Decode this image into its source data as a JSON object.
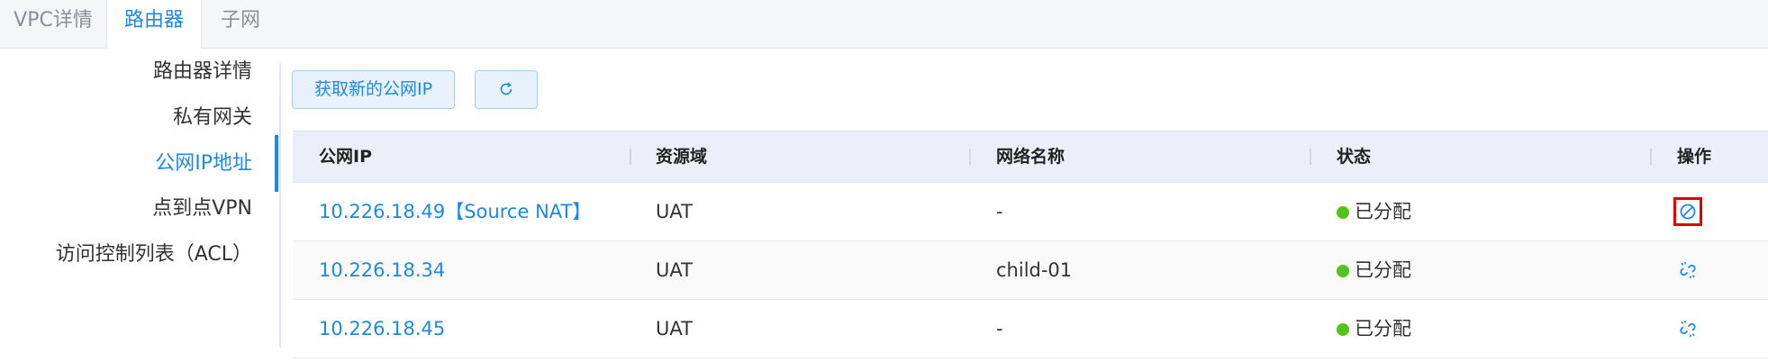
{
  "tabs": [
    {
      "label": "VPC详情",
      "active": false
    },
    {
      "label": "路由器",
      "active": true
    },
    {
      "label": "子网",
      "active": false
    }
  ],
  "nav": {
    "items": [
      {
        "label": "路由器详情",
        "active": false
      },
      {
        "label": "私有网关",
        "active": false
      },
      {
        "label": "公网IP地址",
        "active": true
      },
      {
        "label": "点到点VPN",
        "active": false
      },
      {
        "label": "访问控制列表（ACL）",
        "active": false
      }
    ]
  },
  "toolbar": {
    "acquire_ip_label": "获取新的公网IP",
    "refresh_icon": "refresh-icon"
  },
  "table": {
    "headers": [
      "公网IP",
      "资源域",
      "网络名称",
      "状态",
      "操作"
    ],
    "rows": [
      {
        "ip": "10.226.18.49【Source NAT】",
        "domain": "UAT",
        "network": "-",
        "status": "已分配",
        "action_icon": "disable-icon"
      },
      {
        "ip": "10.226.18.34",
        "domain": "UAT",
        "network": "child-01",
        "status": "已分配",
        "action_icon": "unlink-icon"
      },
      {
        "ip": "10.226.18.45",
        "domain": "UAT",
        "network": "-",
        "status": "已分配",
        "action_icon": "unlink-icon"
      }
    ]
  },
  "colors": {
    "accent": "#1e88e5",
    "status_ok": "#52c41a",
    "highlight": "#e00000",
    "header_bg": "#eceef9"
  }
}
